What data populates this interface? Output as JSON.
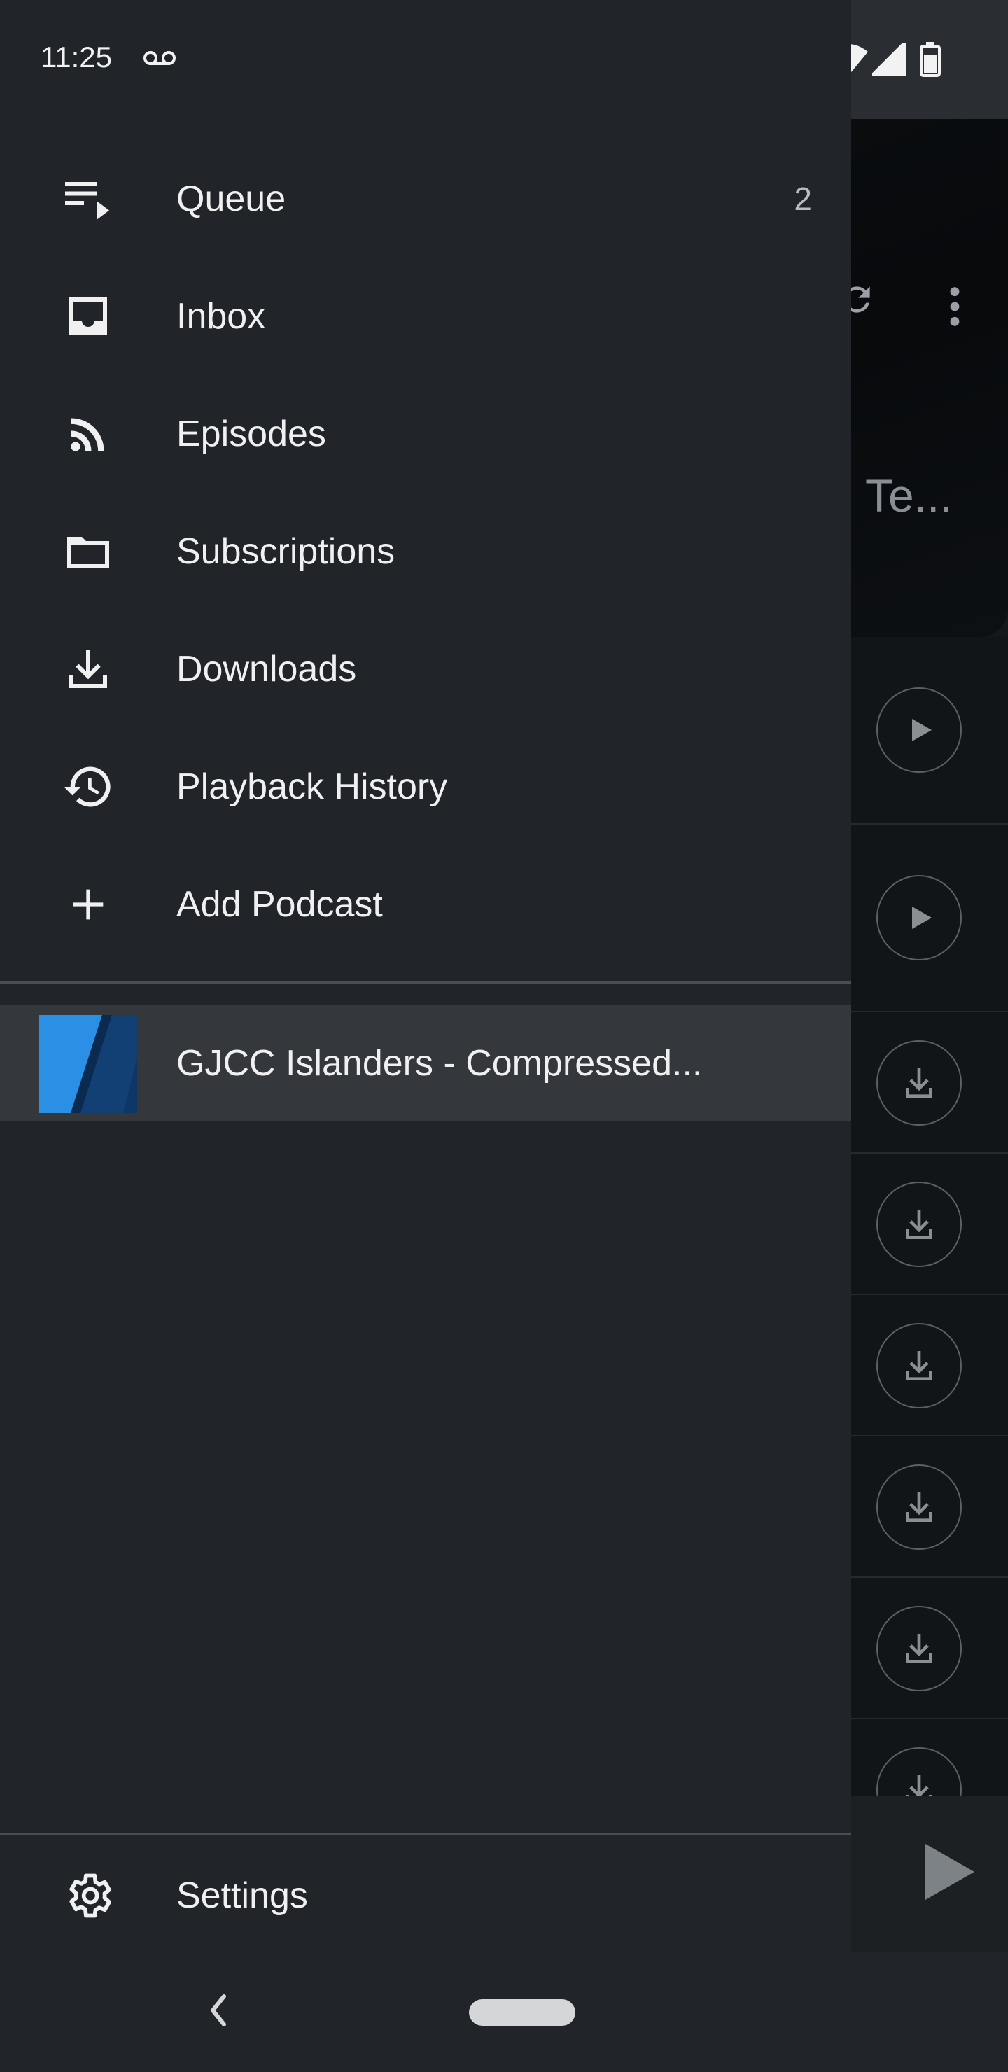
{
  "status_bar": {
    "time": "11:25",
    "icons": [
      "voicemail-icon",
      "wifi-icon",
      "signal-icon",
      "battery-icon"
    ]
  },
  "background_app": {
    "podcast_title_partial": "Te...",
    "episode_buttons": [
      "play",
      "play",
      "download",
      "download",
      "download",
      "download",
      "download",
      "download"
    ]
  },
  "drawer": {
    "items": [
      {
        "label": "Queue",
        "icon": "queue-icon",
        "count": "2"
      },
      {
        "label": "Inbox",
        "icon": "inbox-icon",
        "count": ""
      },
      {
        "label": "Episodes",
        "icon": "rss-icon",
        "count": ""
      },
      {
        "label": "Subscriptions",
        "icon": "folder-icon",
        "count": ""
      },
      {
        "label": "Downloads",
        "icon": "download-icon",
        "count": ""
      },
      {
        "label": "Playback History",
        "icon": "history-icon",
        "count": ""
      },
      {
        "label": "Add Podcast",
        "icon": "plus-icon",
        "count": ""
      }
    ],
    "subscriptions": [
      {
        "label": "GJCC Islanders - Compressed...",
        "cover_colors": [
          "#2b8fe6",
          "#123f74"
        ]
      }
    ],
    "footer": {
      "label": "Settings",
      "icon": "gear-icon"
    }
  },
  "colors": {
    "drawer_bg": "#21252a",
    "selected_bg": "#34383d",
    "text": "#f0f0f0"
  }
}
